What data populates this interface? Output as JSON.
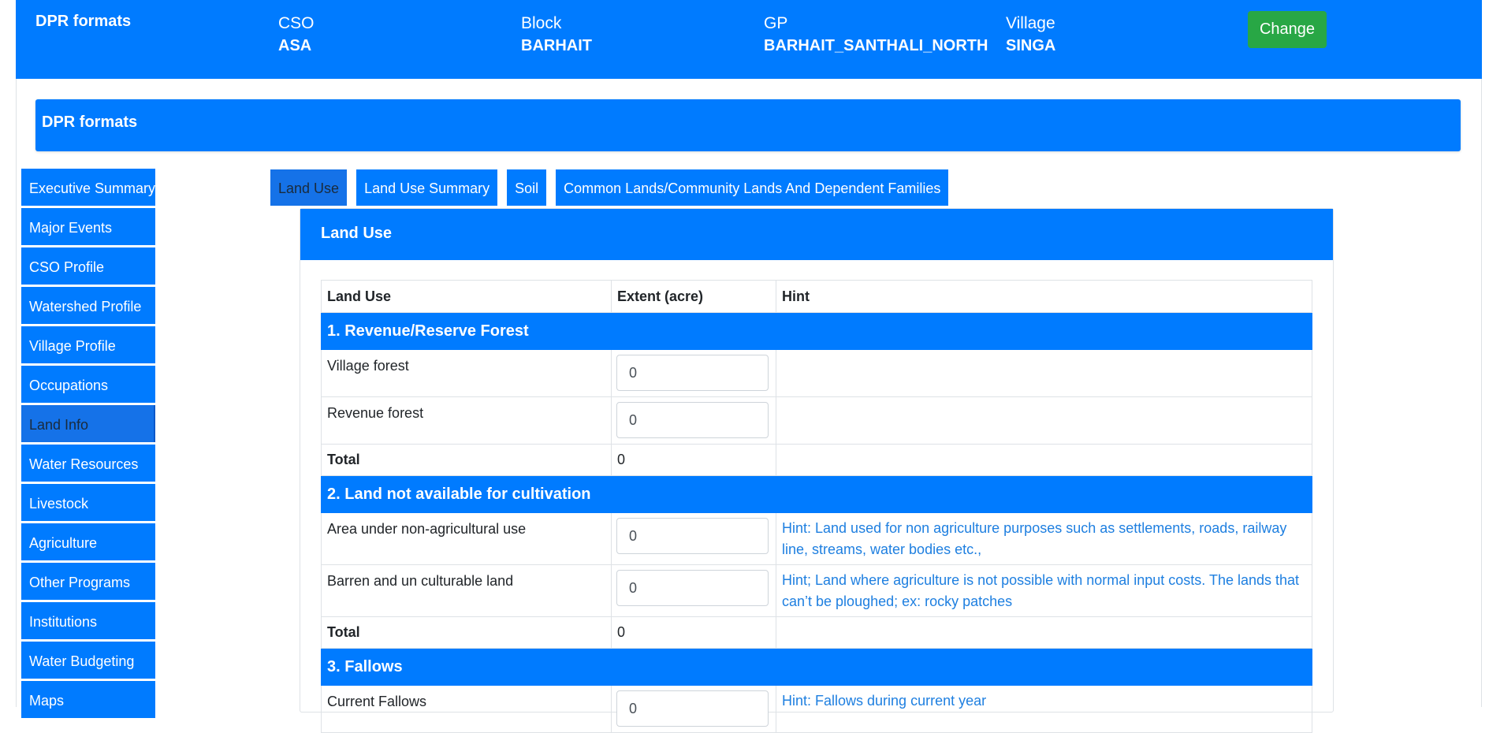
{
  "header": {
    "brand": "DPR formats",
    "cso_label": "CSO",
    "cso_value": "ASA",
    "block_label": "Block",
    "block_value": "BARHAIT",
    "gp_label": "GP",
    "gp_value": "BARHAIT_SANTHALI_NORTH",
    "village_label": "Village",
    "village_value": "SINGA",
    "change_label": "Change"
  },
  "subheader": {
    "title": "DPR formats"
  },
  "sidebar": {
    "items": [
      {
        "label": "Executive Summary"
      },
      {
        "label": "Major Events"
      },
      {
        "label": "CSO Profile"
      },
      {
        "label": "Watershed Profile"
      },
      {
        "label": "Village Profile"
      },
      {
        "label": "Occupations"
      },
      {
        "label": "Land Info"
      },
      {
        "label": "Water Resources"
      },
      {
        "label": "Livestock"
      },
      {
        "label": "Agriculture"
      },
      {
        "label": "Other Programs"
      },
      {
        "label": "Institutions"
      },
      {
        "label": "Water Budgeting"
      },
      {
        "label": "Maps"
      }
    ],
    "active": "Land Info"
  },
  "tabs": {
    "items": [
      {
        "label": "Land Use"
      },
      {
        "label": "Land Use Summary"
      },
      {
        "label": "Soil"
      },
      {
        "label": "Common Lands/Community Lands And Dependent Families"
      }
    ],
    "active": "Land Use"
  },
  "panel": {
    "title": "Land Use",
    "columns": [
      "Land Use",
      "Extent (acre)",
      "Hint"
    ],
    "sections": [
      {
        "title": "1. Revenue/Reserve Forest",
        "rows": [
          {
            "label": "Village forest",
            "value": "0",
            "hint": ""
          },
          {
            "label": "Revenue forest",
            "value": "0",
            "hint": ""
          }
        ],
        "total_label": "Total",
        "total_value": "0"
      },
      {
        "title": "2. Land not available for cultivation",
        "rows": [
          {
            "label": "Area under non-agricultural use",
            "value": "0",
            "hint": "Hint: Land used for non agriculture purposes such as settlements, roads, railway line, streams, water bodies etc.,"
          },
          {
            "label": "Barren and un culturable land",
            "value": "0",
            "hint": "Hint; Land where agriculture is not possible with normal input costs. The lands that can’t be ploughed; ex: rocky patches"
          }
        ],
        "total_label": "Total",
        "total_value": "0"
      },
      {
        "title": "3. Fallows",
        "rows": [
          {
            "label": "Current Fallows",
            "value": "0",
            "hint": "Hint: Fallows during current year"
          }
        ]
      }
    ]
  },
  "colors": {
    "primary": "#007bff",
    "success": "#28a745",
    "hint_text": "#1e7fe0"
  }
}
